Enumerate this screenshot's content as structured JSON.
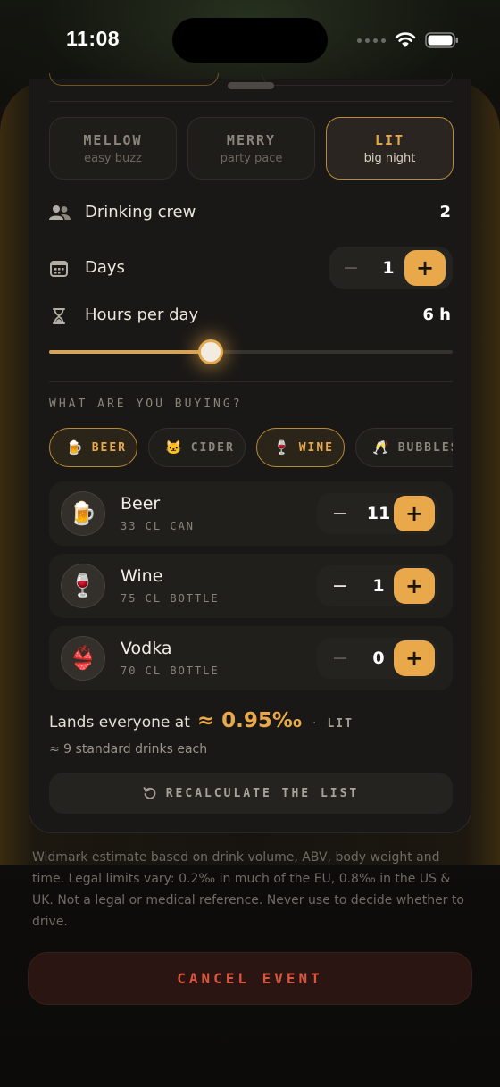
{
  "status_bar": {
    "time": "11:08"
  },
  "modes": [
    {
      "title": "MELLOW",
      "subtitle": "easy buzz",
      "active": false
    },
    {
      "title": "MERRY",
      "subtitle": "party pace",
      "active": false
    },
    {
      "title": "LIT",
      "subtitle": "big night",
      "active": true
    }
  ],
  "crew": {
    "label": "Drinking crew",
    "value": "2",
    "icon": "people-icon"
  },
  "days": {
    "label": "Days",
    "value": "1",
    "icon": "calendar-icon",
    "minus": "−",
    "plus": "+"
  },
  "hours": {
    "label": "Hours per day",
    "value": "6 h",
    "icon": "hourglass-icon",
    "slider_fraction": 0.4
  },
  "buying": {
    "title": "WHAT ARE YOU BUYING?",
    "chips": [
      {
        "emoji": "🍺",
        "label": "BEER",
        "active": true
      },
      {
        "emoji": "🐱",
        "label": "CIDER",
        "active": false
      },
      {
        "emoji": "🍷",
        "label": "WINE",
        "active": true
      },
      {
        "emoji": "🥂",
        "label": "BUBBLES",
        "active": false
      }
    ]
  },
  "drinks": [
    {
      "emoji": "🍺",
      "name": "Beer",
      "size": "33 CL CAN",
      "count": "11"
    },
    {
      "emoji": "🍷",
      "name": "Wine",
      "size": "75 CL BOTTLE",
      "count": "1"
    },
    {
      "emoji": "👙",
      "name": "Vodka",
      "size": "70 CL BOTTLE",
      "count": "0"
    }
  ],
  "stepper": {
    "minus": "−",
    "plus": "+"
  },
  "result": {
    "label": "Lands everyone at",
    "value": "≈ 0.95‰",
    "separator": "·",
    "level": "LIT",
    "std_drinks": "≈ 9 standard drinks each"
  },
  "recalculate": {
    "icon": "refresh-icon",
    "label": "RECALCULATE THE LIST"
  },
  "disclaimer": "Widmark estimate based on drink volume, ABV, body weight and time. Legal limits vary: 0.2‰ in much of the EU, 0.8‰ in the US & UK. Not a legal or medical reference. Never use to decide whether to drive.",
  "cancel": {
    "label": "CANCEL EVENT"
  },
  "colors": {
    "accent": "#e9a84a",
    "danger": "#d8553e",
    "surface": "#1a1816"
  }
}
